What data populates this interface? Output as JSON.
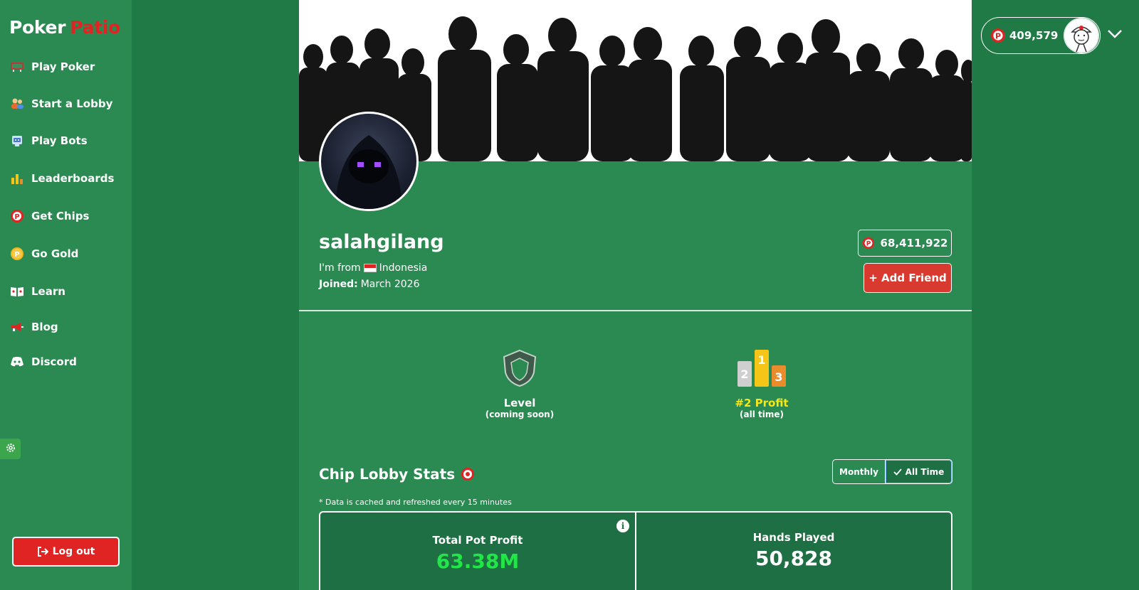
{
  "brand": {
    "name_part1": "Poker",
    "name_part2": "Patio",
    "accent": "#e02424"
  },
  "sidebar": {
    "items": [
      {
        "label": "Play Poker",
        "icon": "table-icon"
      },
      {
        "label": "Start a Lobby",
        "icon": "players-icon"
      },
      {
        "label": "Play Bots",
        "icon": "robot-icon"
      },
      {
        "label": "Leaderboards",
        "icon": "bar-chart-icon"
      },
      {
        "label": "Get Chips",
        "icon": "chip-icon"
      },
      {
        "label": "Go Gold",
        "icon": "gold-coin-icon"
      },
      {
        "label": "Learn",
        "icon": "book-icon"
      },
      {
        "label": "Blog",
        "icon": "megaphone-icon"
      },
      {
        "label": "Discord",
        "icon": "discord-icon"
      }
    ],
    "logout_label": "Log out"
  },
  "header": {
    "balance": "409,579"
  },
  "profile": {
    "username": "salahgilang",
    "from_prefix": "I'm from",
    "country": "Indonesia",
    "joined_label": "Joined:",
    "joined_value": "March 2026",
    "chips": "68,411,922",
    "add_friend_label": "+ Add Friend"
  },
  "badges": {
    "level_title": "Level",
    "level_sub": "(coming soon)",
    "profit_title": "#2 Profit",
    "profit_sub": "(all time)"
  },
  "stats": {
    "title": "Chip Lobby Stats",
    "toggle_monthly": "Monthly",
    "toggle_all_time": "All Time",
    "selected": "All Time",
    "note": "* Data is cached and refreshed every 15 minutes",
    "cells": [
      {
        "label": "Total Pot Profit",
        "value": "63.38M"
      },
      {
        "label": "Hands Played",
        "value": "50,828"
      }
    ]
  }
}
